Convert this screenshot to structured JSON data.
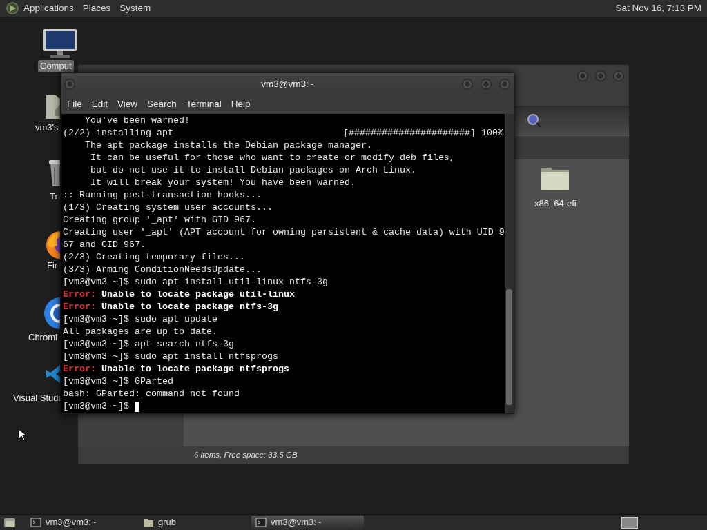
{
  "top_panel": {
    "menus": [
      "Applications",
      "Places",
      "System"
    ],
    "clock": "Sat Nov 16, 7:13 PM"
  },
  "desktop_icons": [
    {
      "label": "Comput",
      "kind": "computer",
      "selected": true
    },
    {
      "label": "vm3's",
      "kind": "home",
      "selected": false
    },
    {
      "label": "Tr",
      "kind": "trash",
      "selected": false
    },
    {
      "label": "Fir",
      "kind": "firefox",
      "selected": false
    },
    {
      "label": "Chromi",
      "kind": "chromium",
      "selected": false
    },
    {
      "label": "Visual Studi",
      "kind": "vscode",
      "selected": false
    }
  ],
  "file_manager": {
    "items": [
      {
        "name": "x86_64-efi"
      }
    ],
    "status": "6 items, Free space: 33.5 GB"
  },
  "terminal": {
    "title": "vm3@vm3:~",
    "menus": [
      "File",
      "Edit",
      "View",
      "Search",
      "Terminal",
      "Help"
    ],
    "lines": [
      {
        "kind": "plain",
        "text": "    You've been warned!"
      },
      {
        "kind": "progress",
        "text": "(2/2) installing apt",
        "bar": "[######################]",
        "percent": "100%"
      },
      {
        "kind": "plain",
        "text": "    The apt package installs the Debian package manager."
      },
      {
        "kind": "plain",
        "text": "     It can be useful for those who want to create or modify deb files,"
      },
      {
        "kind": "plain",
        "text": "     but do not use it to install Debian packages on Arch Linux."
      },
      {
        "kind": "plain",
        "text": "     It will break your system! You have been warned."
      },
      {
        "kind": "plain",
        "text": ":: Running post-transaction hooks..."
      },
      {
        "kind": "plain",
        "text": "(1/3) Creating system user accounts..."
      },
      {
        "kind": "plain",
        "text": "Creating group '_apt' with GID 967."
      },
      {
        "kind": "plain",
        "text": "Creating user '_apt' (APT account for owning persistent & cache data) with UID 9"
      },
      {
        "kind": "plain",
        "text": "67 and GID 967."
      },
      {
        "kind": "plain",
        "text": "(2/3) Creating temporary files..."
      },
      {
        "kind": "plain",
        "text": "(3/3) Arming ConditionNeedsUpdate..."
      },
      {
        "kind": "plain",
        "text": "[vm3@vm3 ~]$ sudo apt install util-linux ntfs-3g"
      },
      {
        "kind": "error",
        "label": "Error:",
        "text": "Unable to locate package util-linux"
      },
      {
        "kind": "error",
        "label": "Error:",
        "text": "Unable to locate package ntfs-3g"
      },
      {
        "kind": "plain",
        "text": "[vm3@vm3 ~]$ sudo apt update"
      },
      {
        "kind": "plain",
        "text": "All packages are up to date."
      },
      {
        "kind": "plain",
        "text": "[vm3@vm3 ~]$ apt search ntfs-3g"
      },
      {
        "kind": "plain",
        "text": "[vm3@vm3 ~]$ sudo apt install ntfsprogs"
      },
      {
        "kind": "error",
        "label": "Error:",
        "text": "Unable to locate package ntfsprogs"
      },
      {
        "kind": "plain",
        "text": "[vm3@vm3 ~]$ GParted"
      },
      {
        "kind": "plain",
        "text": "bash: GParted: command not found"
      },
      {
        "kind": "prompt",
        "text": "[vm3@vm3 ~]$ "
      }
    ]
  },
  "taskbar": {
    "tasks": [
      {
        "label": "vm3@vm3:~",
        "kind": "terminal",
        "selected": false
      },
      {
        "label": "grub",
        "kind": "folder",
        "selected": false
      },
      {
        "label": "vm3@vm3:~",
        "kind": "terminal",
        "selected": true
      }
    ]
  }
}
